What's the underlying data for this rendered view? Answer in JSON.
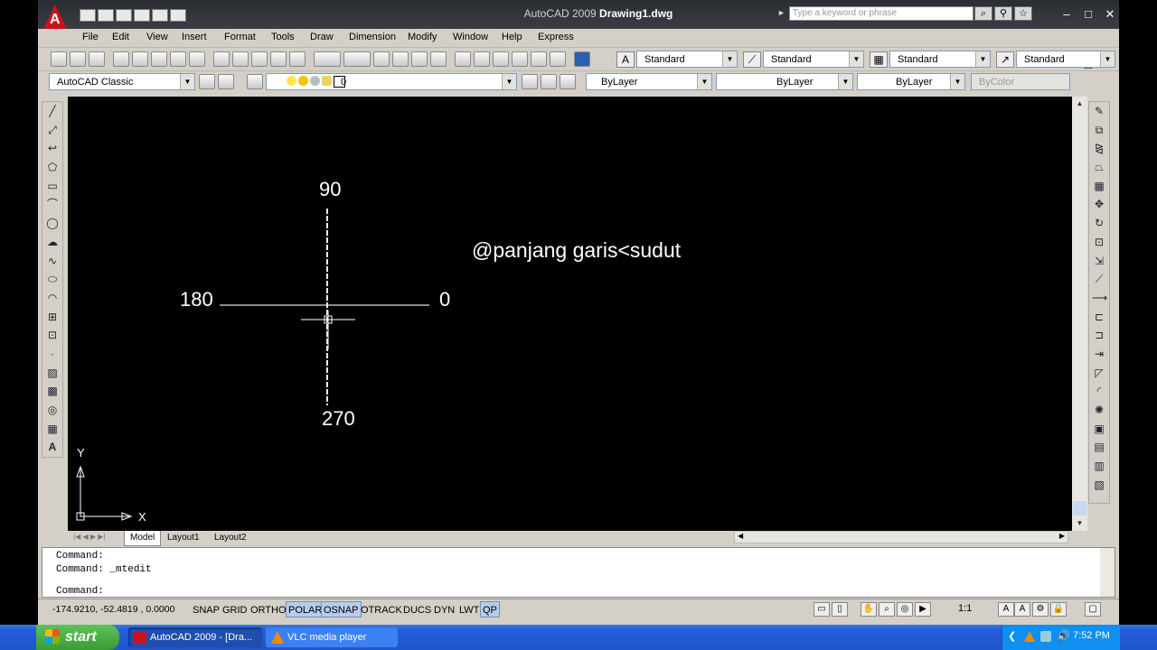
{
  "title": {
    "app": "AutoCAD 2009",
    "document": "Drawing1.dwg"
  },
  "search": {
    "placeholder": "Type a keyword or phrase"
  },
  "menu": [
    "File",
    "Edit",
    "View",
    "Insert",
    "Format",
    "Tools",
    "Draw",
    "Dimension",
    "Modify",
    "Window",
    "Help",
    "Express"
  ],
  "styles": {
    "text_style": "Standard",
    "dim_style": "Standard",
    "table_style": "Standard",
    "multileader_style": "Standard"
  },
  "workspace": "AutoCAD Classic",
  "layer": {
    "current": "0"
  },
  "properties": {
    "color": "ByLayer",
    "linetype": "ByLayer",
    "lineweight": "ByLayer",
    "plotstyle": "ByColor"
  },
  "canvas": {
    "label_90": "90",
    "label_180": "180",
    "label_0": "0",
    "label_270": "270",
    "note": "@panjang garis<sudut",
    "ucs_x": "X",
    "ucs_y": "Y"
  },
  "layout_tabs": [
    "Model",
    "Layout1",
    "Layout2"
  ],
  "command": {
    "line1": "Command:",
    "line2": "Command: _mtedit",
    "prompt": "Command:"
  },
  "status": {
    "coords": "-174.9210, -52.4819 , 0.0000",
    "toggles": [
      {
        "label": "SNAP",
        "on": false
      },
      {
        "label": "GRID",
        "on": false
      },
      {
        "label": "ORTHO",
        "on": false
      },
      {
        "label": "POLAR",
        "on": true
      },
      {
        "label": "OSNAP",
        "on": true
      },
      {
        "label": "OTRACK",
        "on": false
      },
      {
        "label": "DUCS",
        "on": false
      },
      {
        "label": "DYN",
        "on": false
      },
      {
        "label": "LWT",
        "on": false
      },
      {
        "label": "QP",
        "on": true
      }
    ],
    "annotation_scale": "1:1"
  },
  "taskbar": {
    "start": "start",
    "tasks": [
      "AutoCAD 2009 - [Dra...",
      "VLC media player"
    ],
    "clock": "7:52 PM"
  }
}
